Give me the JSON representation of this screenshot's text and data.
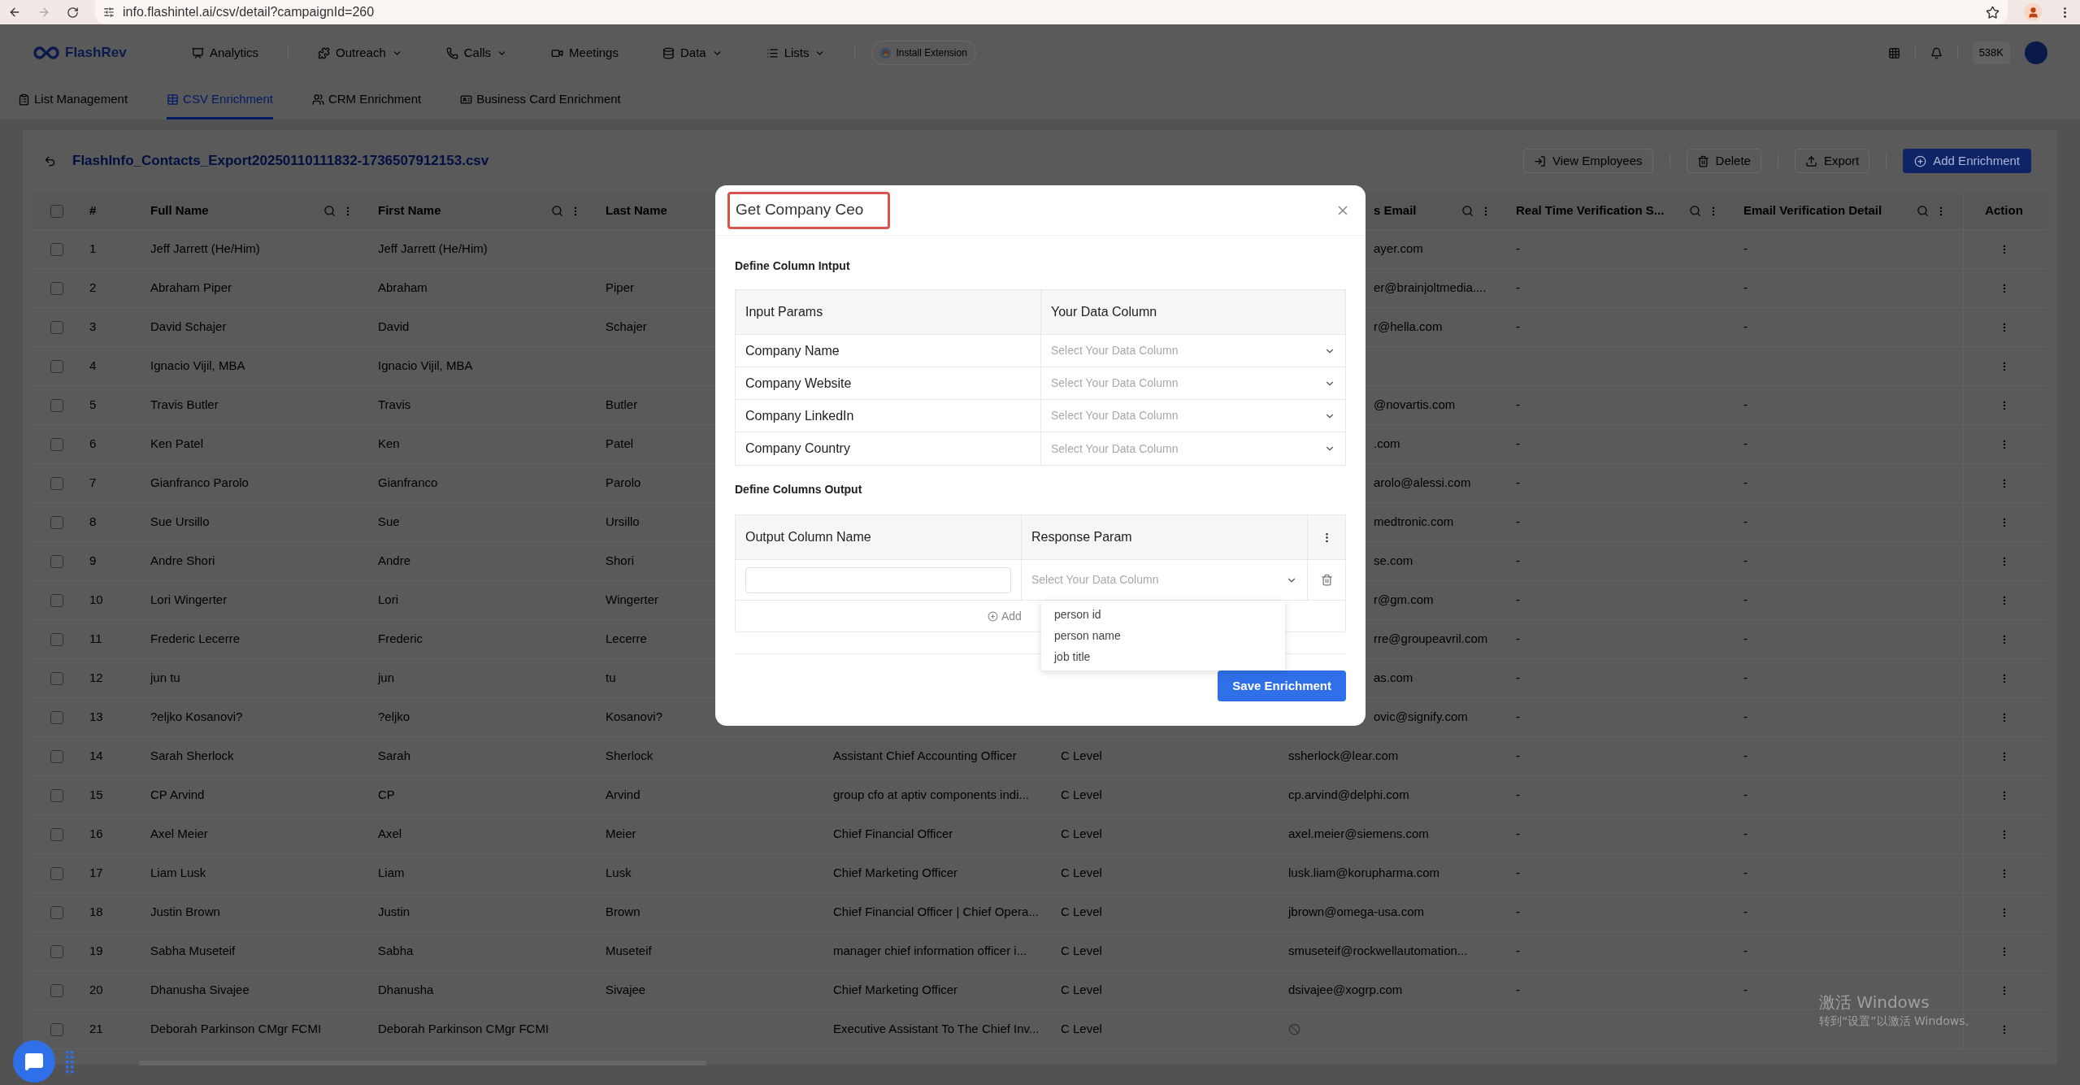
{
  "browser": {
    "url": "info.flashintel.ai/csv/detail?campaignId=260"
  },
  "nav": {
    "logo": "FlashRev",
    "items": [
      {
        "label": "Analytics",
        "dropdown": false
      },
      {
        "label": "Outreach",
        "dropdown": true
      },
      {
        "label": "Calls",
        "dropdown": true
      },
      {
        "label": "Meetings",
        "dropdown": false
      },
      {
        "label": "Data",
        "dropdown": true
      },
      {
        "label": "Lists",
        "dropdown": true
      }
    ],
    "extension": "Install Extension",
    "credits": "538K"
  },
  "tabs": [
    {
      "label": "List Management",
      "selected": false
    },
    {
      "label": "CSV Enrichment",
      "selected": true
    },
    {
      "label": "CRM Enrichment",
      "selected": false
    },
    {
      "label": "Business Card Enrichment",
      "selected": false
    }
  ],
  "file_name": "FlashInfo_Contacts_Export20250110111832-1736507912153.csv",
  "actions": [
    {
      "label": "View Employees",
      "kind": "outline"
    },
    {
      "label": "Delete",
      "kind": "outline"
    },
    {
      "label": "Export",
      "kind": "outline"
    },
    {
      "label": "Add Enrichment",
      "kind": "primary"
    }
  ],
  "table": {
    "all_checked": false,
    "columns": [
      {
        "label": "#",
        "tools": false
      },
      {
        "label": "Full Name",
        "tools": true
      },
      {
        "label": "First Name",
        "tools": true
      },
      {
        "label": "Last Name"
      },
      {
        "label": "s Email",
        "tools": true
      },
      {
        "label": "Real Time Verification S...",
        "tools": true
      },
      {
        "label": "Email Verification Detail",
        "tools": true
      },
      {
        "label": "Action",
        "tools": false
      }
    ],
    "rows": [
      {
        "n": "1",
        "checked": false,
        "full_name": "Jeff Jarrett (He/Him)",
        "first_name": "Jeff Jarrett (He/Him)",
        "email_tail": "ayer.com",
        "real_time": "-",
        "detail": "-",
        "email_blocked": false
      },
      {
        "n": "2",
        "checked": false,
        "full_name": "Abraham Piper",
        "first_name": "Abraham",
        "last_name": "Piper",
        "email_tail": "er@brainjoltmedia....",
        "real_time": "-",
        "detail": "-",
        "email_blocked": false
      },
      {
        "n": "3",
        "checked": false,
        "full_name": "David Schajer",
        "first_name": "David",
        "last_name": "Schajer",
        "email_tail": "r@hella.com",
        "real_time": "-",
        "detail": "-",
        "email_blocked": false
      },
      {
        "n": "4",
        "checked": false,
        "full_name": "Ignacio Vijil, MBA",
        "first_name": "Ignacio Vijil, MBA",
        "email_blocked": false
      },
      {
        "n": "5",
        "checked": false,
        "full_name": "Travis Butler",
        "first_name": "Travis",
        "last_name": "Butler",
        "email_tail": "@novartis.com",
        "real_time": "-",
        "detail": "-",
        "email_blocked": false
      },
      {
        "n": "6",
        "checked": false,
        "full_name": "Ken Patel",
        "first_name": "Ken",
        "last_name": "Patel",
        "email_tail": ".com",
        "real_time": "-",
        "detail": "-",
        "email_blocked": false
      },
      {
        "n": "7",
        "checked": false,
        "full_name": "Gianfranco Parolo",
        "first_name": "Gianfranco",
        "last_name": "Parolo",
        "email_tail": "arolo@alessi.com",
        "real_time": "-",
        "detail": "-",
        "email_blocked": false
      },
      {
        "n": "8",
        "checked": false,
        "full_name": "Sue Ursillo",
        "first_name": "Sue",
        "last_name": "Ursillo",
        "email_tail": "medtronic.com",
        "real_time": "-",
        "detail": "-",
        "email_blocked": false
      },
      {
        "n": "9",
        "checked": false,
        "full_name": "Andre Shori",
        "first_name": "Andre",
        "last_name": "Shori",
        "email_tail": "se.com",
        "real_time": "-",
        "detail": "-",
        "email_blocked": false
      },
      {
        "n": "10",
        "checked": false,
        "full_name": "Lori Wingerter",
        "first_name": "Lori",
        "last_name": "Wingerter",
        "email_tail": "r@gm.com",
        "real_time": "-",
        "detail": "-",
        "email_blocked": false
      },
      {
        "n": "11",
        "checked": false,
        "full_name": "Frederic Lecerre",
        "first_name": "Frederic",
        "last_name": "Lecerre",
        "email_tail": "rre@groupeavril.com",
        "real_time": "-",
        "detail": "-",
        "email_blocked": false
      },
      {
        "n": "12",
        "checked": false,
        "full_name": "jun tu",
        "first_name": "jun",
        "last_name": "tu",
        "email_tail": "as.com",
        "real_time": "-",
        "detail": "-",
        "email_blocked": false
      },
      {
        "n": "13",
        "checked": false,
        "full_name": "?eljko Kosanovi?",
        "first_name": "?eljko",
        "last_name": "Kosanovi?",
        "email_tail": "ovic@signify.com",
        "real_time": "-",
        "detail": "-",
        "email_blocked": false
      },
      {
        "n": "14",
        "checked": false,
        "full_name": "Sarah Sherlock",
        "first_name": "Sarah",
        "last_name": "Sherlock",
        "job_title": "Assistant Chief Accounting Officer",
        "level": "C Level",
        "email": "ssherlock@lear.com",
        "real_time": "-",
        "detail": "-",
        "email_blocked": false
      },
      {
        "n": "15",
        "checked": false,
        "full_name": "CP Arvind",
        "first_name": "CP",
        "last_name": "Arvind",
        "job_title": "group cfo at aptiv components indi...",
        "level": "C Level",
        "email": "cp.arvind@delphi.com",
        "real_time": "-",
        "detail": "-",
        "email_blocked": false
      },
      {
        "n": "16",
        "checked": false,
        "full_name": "Axel Meier",
        "first_name": "Axel",
        "last_name": "Meier",
        "job_title": "Chief Financial Officer",
        "level": "C Level",
        "email": "axel.meier@siemens.com",
        "real_time": "-",
        "detail": "-",
        "email_blocked": false
      },
      {
        "n": "17",
        "checked": false,
        "full_name": "Liam Lusk",
        "first_name": "Liam",
        "last_name": "Lusk",
        "job_title": "Chief Marketing Officer",
        "level": "C Level",
        "email": "lusk.liam@korupharma.com",
        "real_time": "-",
        "detail": "-",
        "email_blocked": false
      },
      {
        "n": "18",
        "checked": false,
        "full_name": "Justin Brown",
        "first_name": "Justin",
        "last_name": "Brown",
        "job_title": "Chief Financial Officer | Chief Opera...",
        "level": "C Level",
        "email": "jbrown@omega-usa.com",
        "real_time": "-",
        "detail": "-",
        "email_blocked": false
      },
      {
        "n": "19",
        "checked": false,
        "full_name": "Sabha Museteif",
        "first_name": "Sabha",
        "last_name": "Museteif",
        "job_title": "manager chief information officer i...",
        "level": "C Level",
        "email": "smuseteif@rockwellautomation...",
        "real_time": "-",
        "detail": "-",
        "email_blocked": false
      },
      {
        "n": "20",
        "checked": false,
        "full_name": "Dhanusha Sivajee",
        "first_name": "Dhanusha",
        "last_name": "Sivajee",
        "job_title": "Chief Marketing Officer",
        "level": "C Level",
        "email": "dsivajee@xogrp.com",
        "real_time": "-",
        "detail": "-",
        "email_blocked": false
      },
      {
        "n": "21",
        "checked": false,
        "full_name": "Deborah Parkinson CMgr FCMI",
        "first_name": "Deborah Parkinson CMgr FCMI",
        "job_title": "Executive Assistant To The Chief Inv...",
        "level": "C Level",
        "email_blocked": true
      }
    ]
  },
  "modal": {
    "title": "Get Company Ceo",
    "input_section": "Define Column Intput",
    "input_headers": [
      "Input Params",
      "Your Data Column"
    ],
    "inputs": [
      {
        "param": "Company Name",
        "placeholder": "Select Your Data Column"
      },
      {
        "param": "Company Website",
        "placeholder": "Select Your Data Column"
      },
      {
        "param": "Company LinkedIn",
        "placeholder": "Select Your Data Column"
      },
      {
        "param": "Company Country",
        "placeholder": "Select Your Data Column"
      }
    ],
    "output_section": "Define Columns Output",
    "output_headers": [
      "Output Column Name",
      "Response Param"
    ],
    "output_rows": [
      {
        "placeholder": "Select Your Data Column",
        "expanded": true
      }
    ],
    "add_label": "Add",
    "options": [
      "person id",
      "person name",
      "job title"
    ],
    "save": "Save Enrichment"
  },
  "os_notice": {
    "title": "激活 Windows",
    "subtitle": "转到“设置”以激活 Windows。"
  }
}
